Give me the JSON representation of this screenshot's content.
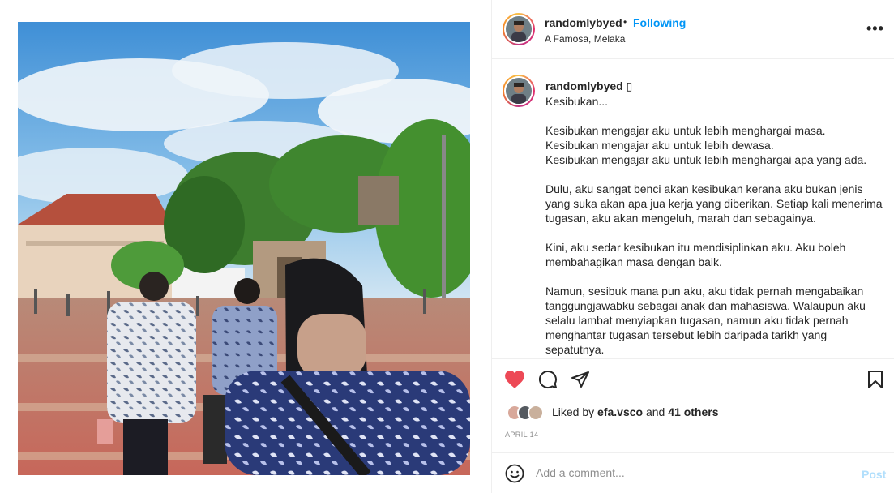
{
  "header": {
    "username": "randomlybyed",
    "separator": "•",
    "follow_label": "Following",
    "location": "A Famosa, Melaka",
    "more_icon": "more-horizontal-icon"
  },
  "caption": {
    "username": "randomlybyed",
    "badge": "▯",
    "paragraphs": [
      "Kesibukan...",
      "Kesibukan mengajar aku untuk lebih menghargai masa.\nKesibukan mengajar aku untuk lebih dewasa.\nKesibukan mengajar aku untuk lebih menghargai apa yang ada.",
      "Dulu, aku sangat benci akan kesibukan kerana aku bukan jenis yang suka akan apa jua kerja yang diberikan. Setiap kali menerima tugasan, aku akan mengeluh, marah dan sebagainya.",
      "Kini, aku sedar kesibukan itu mendisiplinkan aku. Aku boleh membahagikan masa dengan baik.",
      "Namun, sesibuk mana pun aku, aku tidak pernah mengabaikan tanggungjawabku sebagai anak dan mahasiswa. Walaupun aku selalu lambat menyiapkan tugasan, namun aku tidak pernah menghantar tugasan tersebut lebih daripada tarikh yang sepatutnya."
    ]
  },
  "actions": {
    "like_icon": "heart-filled-icon",
    "comment_icon": "comment-icon",
    "share_icon": "send-icon",
    "save_icon": "bookmark-icon",
    "liked": true,
    "like_color": "#ed4956"
  },
  "likes": {
    "prefix": "Liked by ",
    "user": "efa.vsco",
    "middle": " and ",
    "others": "41 others"
  },
  "date": "APRIL 14",
  "comment": {
    "emoji_icon": "smiley-icon",
    "placeholder": "Add a comment...",
    "post_label": "Post"
  },
  "colors": {
    "accent": "#0095f6",
    "post_disabled": "#b2dffc",
    "muted": "#8e8e8e"
  }
}
